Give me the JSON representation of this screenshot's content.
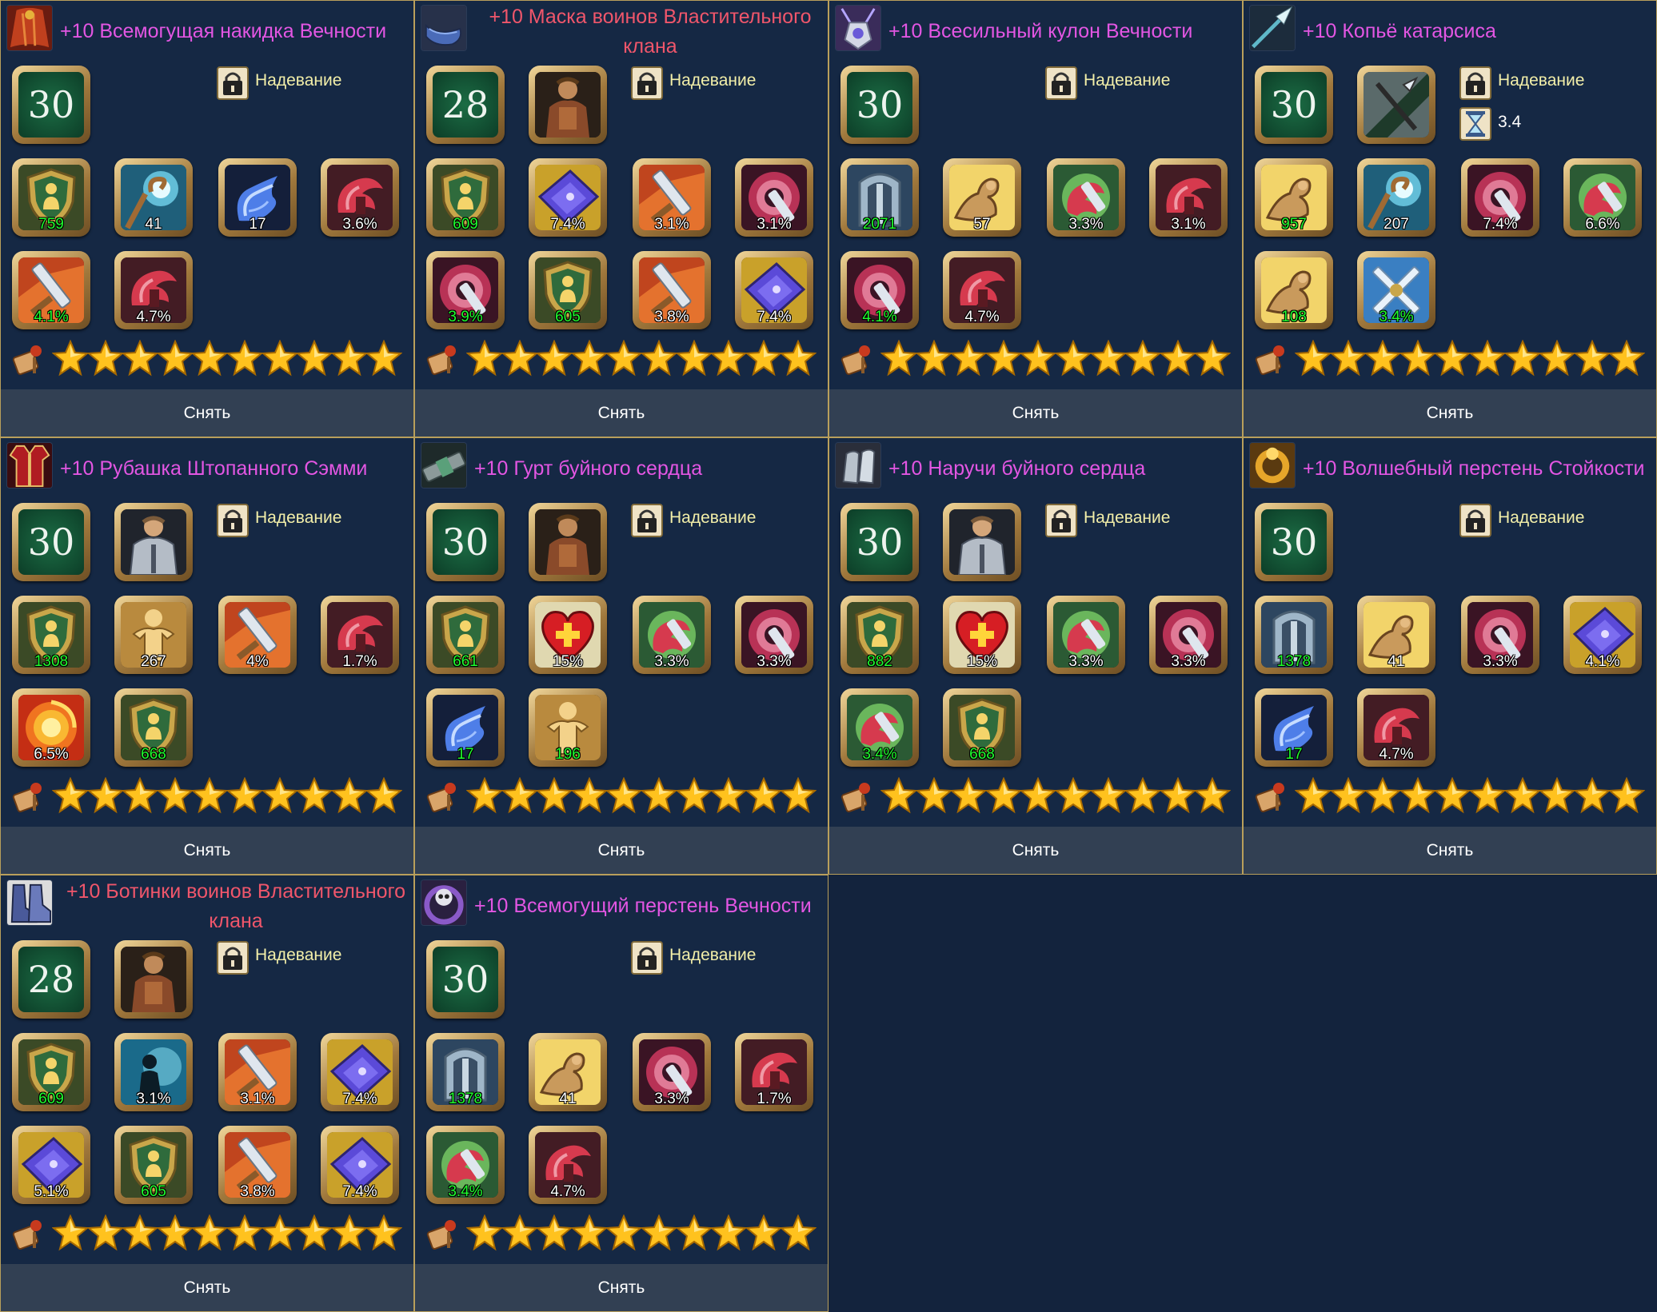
{
  "items": [
    {
      "title": "+10 Всемогущая накидка Вечности",
      "title_color": "#e356e3",
      "icon": "cape-icon",
      "level": "30",
      "class_icon": null,
      "equip_label": "Надевание",
      "speed": null,
      "stats": [
        {
          "icon": "shield-defense-icon",
          "value": "759",
          "green": true
        },
        {
          "icon": "staff-magic-icon",
          "value": "41",
          "green": false
        },
        {
          "icon": "blue-wing-icon",
          "value": "17",
          "green": false
        },
        {
          "icon": "red-crit-icon",
          "value": "3.6%",
          "green": false
        },
        {
          "icon": "sword-hit-icon",
          "value": "4.1%",
          "green": true
        },
        {
          "icon": "red-crit-icon",
          "value": "4.7%",
          "green": false
        }
      ],
      "stars": 10,
      "remove_label": "Снять"
    },
    {
      "title": "+10 Маска воинов Властительного клана",
      "title_color": "#f0566b",
      "icon": "mask-icon",
      "level": "28",
      "class_icon": "warrior-class-icon",
      "equip_label": "Надевание",
      "speed": null,
      "stats": [
        {
          "icon": "shield-defense-icon",
          "value": "609",
          "green": true
        },
        {
          "icon": "purple-book-icon",
          "value": "7.4%",
          "green": false
        },
        {
          "icon": "sword-hit-icon",
          "value": "3.1%",
          "green": false
        },
        {
          "icon": "pink-swirl-icon",
          "value": "3.1%",
          "green": false
        },
        {
          "icon": "pink-swirl-icon",
          "value": "3.9%",
          "green": true
        },
        {
          "icon": "shield-defense-icon",
          "value": "605",
          "green": true
        },
        {
          "icon": "sword-hit-icon",
          "value": "3.8%",
          "green": false
        },
        {
          "icon": "purple-book-icon",
          "value": "7.4%",
          "green": false
        }
      ],
      "stars": 10,
      "remove_label": "Снять"
    },
    {
      "title": "+10 Всесильный кулон Вечности",
      "title_color": "#e356e3",
      "icon": "pendant-icon",
      "level": "30",
      "class_icon": null,
      "equip_label": "Надевание",
      "speed": null,
      "stats": [
        {
          "icon": "silver-shield-icon",
          "value": "2071",
          "green": true
        },
        {
          "icon": "muscle-arm-icon",
          "value": "57",
          "green": false
        },
        {
          "icon": "green-crit-icon",
          "value": "3.3%",
          "green": false
        },
        {
          "icon": "red-crit-icon",
          "value": "3.1%",
          "green": false
        },
        {
          "icon": "pink-swirl-icon",
          "value": "4.1%",
          "green": true
        },
        {
          "icon": "red-crit-icon",
          "value": "4.7%",
          "green": false
        }
      ],
      "stars": 10,
      "remove_label": "Снять"
    },
    {
      "title": "+10 Копьё катарсиса",
      "title_color": "#e356e3",
      "icon": "spear-icon",
      "level": "30",
      "class_icon": "spear-class-icon",
      "equip_label": "Надевание",
      "speed": "3.4",
      "stats": [
        {
          "icon": "muscle-arm-icon",
          "value": "957",
          "green": true
        },
        {
          "icon": "staff-magic-icon",
          "value": "207",
          "green": false
        },
        {
          "icon": "pink-swirl-icon",
          "value": "7.4%",
          "green": false
        },
        {
          "icon": "green-crit-icon",
          "value": "6.6%",
          "green": false
        },
        {
          "icon": "muscle-arm-icon",
          "value": "108",
          "green": true
        },
        {
          "icon": "crossed-swords-icon",
          "value": "3.4%",
          "green": true
        }
      ],
      "stars": 10,
      "remove_label": "Снять"
    },
    {
      "title": "+10 Рубашка Штопанного Сэмми",
      "title_color": "#e356e3",
      "icon": "shirt-icon",
      "level": "30",
      "class_icon": "knight-class-icon",
      "equip_label": "Надевание",
      "speed": null,
      "stats": [
        {
          "icon": "shield-defense-icon",
          "value": "1308",
          "green": true
        },
        {
          "icon": "golden-body-icon",
          "value": "267",
          "green": false
        },
        {
          "icon": "sword-hit-icon",
          "value": "4%",
          "green": false
        },
        {
          "icon": "red-crit-icon",
          "value": "1.7%",
          "green": false
        },
        {
          "icon": "fire-swirl-icon",
          "value": "6.5%",
          "green": false
        },
        {
          "icon": "shield-defense-icon",
          "value": "668",
          "green": true
        }
      ],
      "stars": 10,
      "remove_label": "Снять"
    },
    {
      "title": "+10 Гурт буйного сердца",
      "title_color": "#e356e3",
      "icon": "belt-icon",
      "level": "30",
      "class_icon": "warrior-class-icon",
      "equip_label": "Надевание",
      "speed": null,
      "stats": [
        {
          "icon": "shield-defense-icon",
          "value": "661",
          "green": true
        },
        {
          "icon": "heart-plus-icon",
          "value": "15%",
          "green": false
        },
        {
          "icon": "green-crit-icon",
          "value": "3.3%",
          "green": false
        },
        {
          "icon": "pink-swirl-icon",
          "value": "3.3%",
          "green": false
        },
        {
          "icon": "blue-wing-icon",
          "value": "17",
          "green": true
        },
        {
          "icon": "golden-body-icon",
          "value": "196",
          "green": true
        }
      ],
      "stars": 10,
      "remove_label": "Снять"
    },
    {
      "title": "+10 Наручи буйного сердца",
      "title_color": "#e356e3",
      "icon": "bracers-icon",
      "level": "30",
      "class_icon": "knight-class-icon",
      "equip_label": "Надевание",
      "speed": null,
      "stats": [
        {
          "icon": "shield-defense-icon",
          "value": "882",
          "green": true
        },
        {
          "icon": "heart-plus-icon",
          "value": "15%",
          "green": false
        },
        {
          "icon": "green-crit-icon",
          "value": "3.3%",
          "green": false
        },
        {
          "icon": "pink-swirl-icon",
          "value": "3.3%",
          "green": false
        },
        {
          "icon": "green-crit-icon",
          "value": "3.4%",
          "green": true
        },
        {
          "icon": "shield-defense-icon",
          "value": "668",
          "green": true
        }
      ],
      "stars": 10,
      "remove_label": "Снять"
    },
    {
      "title": "+10 Волшебный перстень Стойкости",
      "title_color": "#e356e3",
      "icon": "gold-ring-icon",
      "level": "30",
      "class_icon": null,
      "equip_label": "Надевание",
      "speed": null,
      "stats": [
        {
          "icon": "silver-shield-icon",
          "value": "1378",
          "green": true
        },
        {
          "icon": "muscle-arm-icon",
          "value": "41",
          "green": false
        },
        {
          "icon": "pink-swirl-icon",
          "value": "3.3%",
          "green": false
        },
        {
          "icon": "purple-book-icon",
          "value": "4.1%",
          "green": false
        },
        {
          "icon": "blue-wing-icon",
          "value": "17",
          "green": true
        },
        {
          "icon": "red-crit-icon",
          "value": "4.7%",
          "green": false
        }
      ],
      "stars": 10,
      "remove_label": "Снять"
    },
    {
      "title": "+10 Ботинки воинов Властительного клана",
      "title_color": "#f0566b",
      "icon": "boots-icon",
      "level": "28",
      "class_icon": "warrior-class-icon",
      "equip_label": "Надевание",
      "speed": null,
      "stats": [
        {
          "icon": "shield-defense-icon",
          "value": "609",
          "green": true
        },
        {
          "icon": "dark-figure-icon",
          "value": "3.1%",
          "green": false
        },
        {
          "icon": "sword-hit-icon",
          "value": "3.1%",
          "green": false
        },
        {
          "icon": "purple-book-icon",
          "value": "7.4%",
          "green": false
        },
        {
          "icon": "purple-book-icon",
          "value": "5.1%",
          "green": false
        },
        {
          "icon": "shield-defense-icon",
          "value": "605",
          "green": true
        },
        {
          "icon": "sword-hit-icon",
          "value": "3.8%",
          "green": false
        },
        {
          "icon": "purple-book-icon",
          "value": "7.4%",
          "green": false
        }
      ],
      "stars": 10,
      "remove_label": "Снять"
    },
    {
      "title": "+10 Всемогущий перстень Вечности",
      "title_color": "#e356e3",
      "icon": "skull-ring-icon",
      "level": "30",
      "class_icon": null,
      "equip_label": "Надевание",
      "speed": null,
      "stats": [
        {
          "icon": "silver-shield-icon",
          "value": "1378",
          "green": true
        },
        {
          "icon": "muscle-arm-icon",
          "value": "41",
          "green": false
        },
        {
          "icon": "pink-swirl-icon",
          "value": "3.3%",
          "green": false
        },
        {
          "icon": "red-crit-icon",
          "value": "1.7%",
          "green": false
        },
        {
          "icon": "green-crit-icon",
          "value": "3.4%",
          "green": true
        },
        {
          "icon": "red-crit-icon",
          "value": "4.7%",
          "green": false
        }
      ],
      "stars": 10,
      "remove_label": "Снять"
    }
  ],
  "colors": {
    "background": "#13233d",
    "card": "#152844",
    "border": "#b99f5b",
    "button": "#324053",
    "epic_title": "#e356e3",
    "set_title": "#f0566b",
    "equip_text": "#f3efa9",
    "stat_value": "#1fff2e"
  }
}
